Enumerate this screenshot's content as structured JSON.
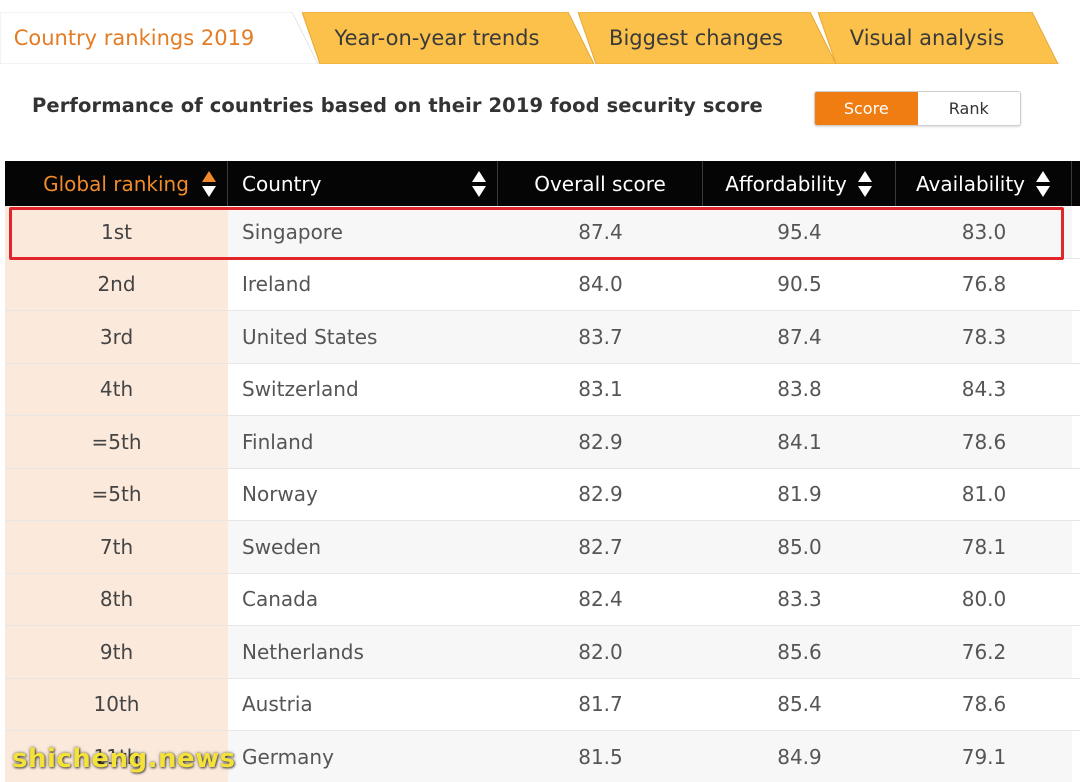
{
  "tabs": [
    {
      "label": "Country rankings 2019",
      "active": true
    },
    {
      "label": "Year-on-year trends",
      "active": false
    },
    {
      "label": "Biggest changes",
      "active": false
    },
    {
      "label": "Visual analysis",
      "active": false
    }
  ],
  "heading": "Performance of countries based on their 2019 food security score",
  "toggle": {
    "score_label": "Score",
    "rank_label": "Rank",
    "selected": "Score"
  },
  "table": {
    "columns": [
      "Global ranking",
      "Country",
      "Overall score",
      "Affordability",
      "Availability"
    ],
    "rows": [
      {
        "rank": "1st",
        "country": "Singapore",
        "overall": "87.4",
        "affordability": "95.4",
        "availability": "83.0"
      },
      {
        "rank": "2nd",
        "country": "Ireland",
        "overall": "84.0",
        "affordability": "90.5",
        "availability": "76.8"
      },
      {
        "rank": "3rd",
        "country": "United States",
        "overall": "83.7",
        "affordability": "87.4",
        "availability": "78.3"
      },
      {
        "rank": "4th",
        "country": "Switzerland",
        "overall": "83.1",
        "affordability": "83.8",
        "availability": "84.3"
      },
      {
        "rank": "=5th",
        "country": "Finland",
        "overall": "82.9",
        "affordability": "84.1",
        "availability": "78.6"
      },
      {
        "rank": "=5th",
        "country": "Norway",
        "overall": "82.9",
        "affordability": "81.9",
        "availability": "81.0"
      },
      {
        "rank": "7th",
        "country": "Sweden",
        "overall": "82.7",
        "affordability": "85.0",
        "availability": "78.1"
      },
      {
        "rank": "8th",
        "country": "Canada",
        "overall": "82.4",
        "affordability": "83.3",
        "availability": "80.0"
      },
      {
        "rank": "9th",
        "country": "Netherlands",
        "overall": "82.0",
        "affordability": "85.6",
        "availability": "76.2"
      },
      {
        "rank": "10th",
        "country": "Austria",
        "overall": "81.7",
        "affordability": "85.4",
        "availability": "78.6"
      },
      {
        "rank": "11th",
        "country": "Germany",
        "overall": "81.5",
        "affordability": "84.9",
        "availability": "79.1"
      }
    ]
  },
  "watermark": "shicheng.news",
  "colors": {
    "tab_inactive": "#fbc14b",
    "tab_active_text": "#e37c23",
    "accent": "#f07d12",
    "header_bg": "#050505",
    "rank_cell_bg": "#fbe9dc",
    "highlight_border": "#e0262a"
  }
}
